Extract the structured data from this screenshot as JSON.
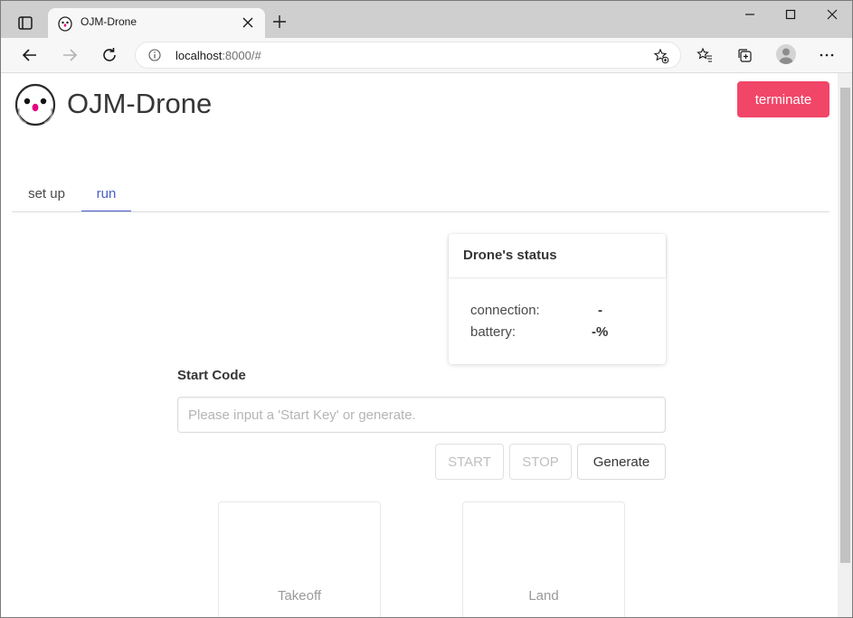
{
  "browser": {
    "tab_title": "OJM-Drone",
    "url_host": "localhost",
    "url_rest": ":8000/#"
  },
  "app": {
    "brand": "OJM-Drone",
    "terminate_label": "terminate",
    "tabs": [
      {
        "label": "set up",
        "active": false
      },
      {
        "label": "run",
        "active": true
      }
    ]
  },
  "status": {
    "title": "Drone's status",
    "connection_label": "connection:",
    "connection_value": "-",
    "battery_label": "battery:",
    "battery_value": "-%"
  },
  "start_code": {
    "label": "Start Code",
    "placeholder": "Please input a 'Start Key' or generate.",
    "value": "",
    "start_label": "START",
    "stop_label": "STOP",
    "generate_label": "Generate"
  },
  "controls": {
    "takeoff_label": "Takeoff",
    "land_label": "Land"
  },
  "colors": {
    "accent_danger": "#f14668",
    "tab_active": "#485fc7",
    "titlebar": "#cfcfcf"
  }
}
